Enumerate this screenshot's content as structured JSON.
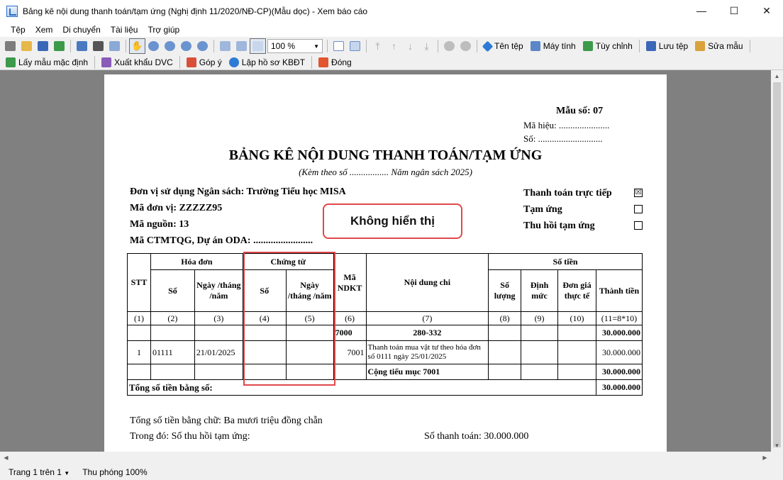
{
  "window": {
    "title": "Bảng kê nội dung thanh toán/tạm ứng (Nghị định 11/2020/NĐ-CP)(Mẫu dọc) - Xem báo cáo",
    "minimize": "—",
    "maximize": "☐",
    "close": "✕"
  },
  "menu": [
    "Tệp",
    "Xem",
    "Di chuyển",
    "Tài liệu",
    "Trợ giúp"
  ],
  "toolbar": {
    "zoom_value": "100 %",
    "file_name": "Tên tệp",
    "calculator": "Máy tính",
    "customize": "Tùy chỉnh",
    "save_file": "Lưu tệp",
    "edit_template": "Sửa mẫu",
    "default_template": "Lấy mẫu mặc định",
    "export_dvc": "Xuất khẩu DVC",
    "feedback": "Góp ý",
    "kbdt": "Lập hồ sơ KBĐT",
    "close": "Đóng"
  },
  "report": {
    "form_no": "Mẫu số: 07",
    "code": "Mã hiệu: ......................",
    "number": "Số: ............................",
    "title": "BẢNG KÊ NỘI DUNG THANH TOÁN/TẠM ỨNG",
    "subtitle": "(Kèm theo  số ................. Năm ngân sách 2025)",
    "unit": "Đơn vị sử dụng Ngân sách: Trường Tiểu học MISA",
    "unit_code": "Mã đơn vị:  ZZZZZ95",
    "source_code": "Mã nguồn:  13",
    "project": "Mã CTMTQG, Dự án ODA: ........................",
    "options": [
      {
        "label": "Thanh toán trực tiếp",
        "checked": "☒"
      },
      {
        "label": "Tạm ứng",
        "checked": ""
      },
      {
        "label": "Thu hồi tạm ứng",
        "checked": ""
      }
    ],
    "table": {
      "h_stt": "STT",
      "h_invoice": "Hóa đơn",
      "h_voucher": "Chứng từ",
      "h_ndkt": "Mã NDKT",
      "h_content": "Nội dung chi",
      "h_amount": "Số tiền",
      "h_no": "Số",
      "h_date": "Ngày /tháng /năm",
      "h_qty": "Số lượng",
      "h_norm": "Định mức",
      "h_price": "Đơn giá thực tế",
      "h_total": "Thành tiền",
      "idx": [
        "(1)",
        "(2)",
        "(3)",
        "(4)",
        "(5)",
        "(6)",
        "(7)",
        "(8)",
        "(9)",
        "(10)",
        "(11=8*10)"
      ],
      "group_code": "7000",
      "group_range": "280-332",
      "group_total": "30.000.000",
      "row_stt": "1",
      "row_invoice_no": "01111",
      "row_invoice_date": "21/01/2025",
      "row_ndkt": "7001",
      "row_content": "Thanh toán mua vật tư theo hóa đơn số 0111 ngày 25/01/2025",
      "row_total": "30.000.000",
      "subtotal_label": "Cộng tiểu mục 7001",
      "subtotal_value": "30.000.000",
      "grand_label": "Tổng số tiền bằng số:",
      "grand_value": "30.000.000"
    },
    "in_words": "Tổng số tiền bằng chữ: Ba mươi triệu đồng chẵn",
    "advance_recovered": "Trong đó:  Số thu hồi tạm ứng:",
    "payment": "Số thanh toán: 30.000.000"
  },
  "callout": "Không hiển thị",
  "status": {
    "page": "Trang 1 trên 1",
    "zoom": "Thu phóng 100%"
  }
}
